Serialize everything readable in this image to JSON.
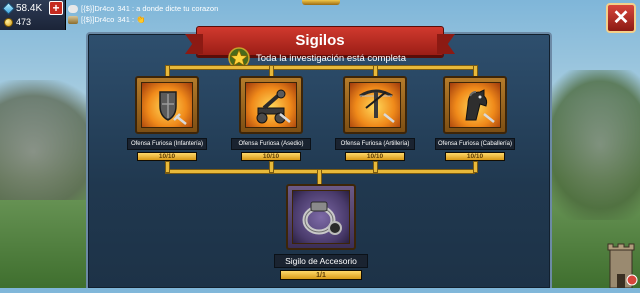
{
  "hud": {
    "gems": "58.4K",
    "gold": "473",
    "add_label": "+"
  },
  "chat": {
    "messages": [
      {
        "sender": "[{$}]Dr4co",
        "text": "341 : a donde dicte tu corazon"
      },
      {
        "sender": "[{$}]Dr4co",
        "text": "341 : 👏"
      }
    ]
  },
  "panel": {
    "title": "Sigilos",
    "status": "Toda la investigación está completa",
    "close_label": "✕"
  },
  "sigils": [
    {
      "name": "Ofensa Furiosa (Infantería)",
      "progress_text": "10/10",
      "progress": 1.0,
      "icon": "shield-sword-icon"
    },
    {
      "name": "Ofensa Furiosa (Asedio)",
      "progress_text": "10/10",
      "progress": 1.0,
      "icon": "catapult-icon"
    },
    {
      "name": "Ofensa Furiosa (Artillería)",
      "progress_text": "10/10",
      "progress": 1.0,
      "icon": "crossbow-icon"
    },
    {
      "name": "Ofensa Furiosa (Caballería)",
      "progress_text": "10/10",
      "progress": 1.0,
      "icon": "horse-icon"
    }
  ],
  "accessory": {
    "name": "Sigilo de Accesorio",
    "progress_text": "1/1",
    "progress": 1.0,
    "icon": "ring-icon"
  },
  "colors": {
    "panel": "#24405a",
    "banner": "#c2322a",
    "gold": "#e8b93a",
    "progress_fill": "#f2c343"
  }
}
